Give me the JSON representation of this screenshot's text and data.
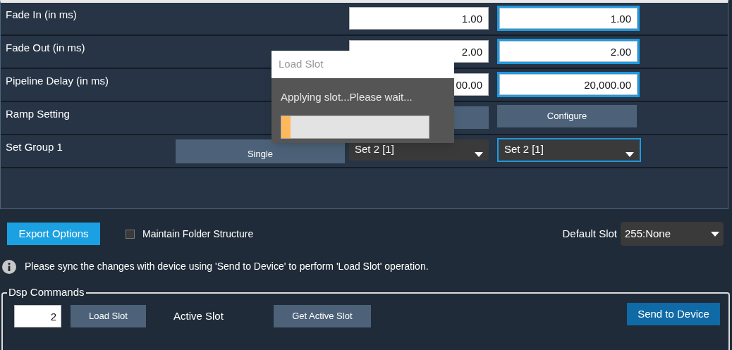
{
  "settings_rows": [
    {
      "kind": "inputs",
      "label": "Fade In (in ms)",
      "values": [
        "1.00",
        "1.00"
      ]
    },
    {
      "kind": "inputs",
      "label": "Fade Out (in ms)",
      "values": [
        "2.00",
        "2.00"
      ]
    },
    {
      "kind": "inputs",
      "label": "Pipeline Delay (in ms)",
      "values": [
        "00.00",
        "20,000.00"
      ]
    },
    {
      "kind": "buttons",
      "label": "Ramp Setting",
      "values": [
        "Configure"
      ]
    },
    {
      "kind": "dropdowns",
      "label": "Set Group 1",
      "mode": "Single",
      "values": [
        "Set 2 [1]",
        "Set 2 [1]"
      ]
    }
  ],
  "dialog": {
    "title": "Load Slot",
    "message": "Applying slot...Please wait...",
    "level": 0.06
  },
  "export_button": "Export Options",
  "maintain_folder_structure": {
    "label": "Maintain Folder Structure",
    "checked": false
  },
  "default_slot": {
    "label": "Default Slot",
    "value": "255:None"
  },
  "info_message": "Please sync the changes with device using 'Send to Device' to perform 'Load Slot' operation.",
  "dsp_commands": {
    "title": "Dsp Commands",
    "slot_value": "2",
    "load_button": "Load Slot",
    "active_slot_label": "Active Slot",
    "get_active_button": "Get Active Slot",
    "send_button": "Send to Device"
  }
}
